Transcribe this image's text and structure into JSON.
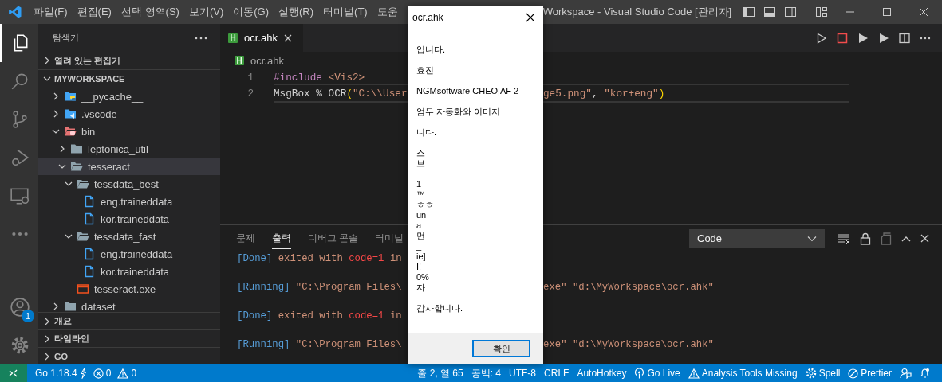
{
  "title_bar": {
    "menu": [
      "파일(F)",
      "편집(E)",
      "선택 영역(S)",
      "보기(V)",
      "이동(G)",
      "실행(R)",
      "터미널(T)",
      "도움"
    ],
    "title": "Workspace - Visual Studio Code [관리자]"
  },
  "activity_bar": {
    "items": [
      {
        "kind": "explorer",
        "selected": true
      },
      {
        "kind": "search",
        "selected": false
      },
      {
        "kind": "source-control",
        "selected": false
      },
      {
        "kind": "run-debug",
        "selected": false
      },
      {
        "kind": "remote",
        "selected": false
      },
      {
        "kind": "more",
        "selected": false
      }
    ],
    "accounts_badge": "1"
  },
  "sidebar": {
    "title": "탐색기",
    "open_editors": {
      "label": "열려 있는 편집기",
      "expanded": false
    },
    "workspace": {
      "label": "MYWORKSPACE",
      "expanded": true,
      "tree": [
        {
          "name": "__pycache__",
          "kind": "folder-python",
          "expanded": false,
          "selected": false
        },
        {
          "name": ".vscode",
          "kind": "folder-vscode",
          "expanded": false,
          "selected": false
        },
        {
          "name": "bin",
          "kind": "folder-bin",
          "expanded": true,
          "selected": false,
          "children": [
            {
              "name": "leptonica_util",
              "kind": "folder",
              "expanded": false,
              "selected": false
            },
            {
              "name": "tesseract",
              "kind": "folder",
              "expanded": true,
              "selected": true,
              "children": [
                {
                  "name": "tessdata_best",
                  "kind": "folder",
                  "expanded": true,
                  "selected": false,
                  "children": [
                    {
                      "name": "eng.traineddata",
                      "kind": "file",
                      "selected": false
                    },
                    {
                      "name": "kor.traineddata",
                      "kind": "file",
                      "selected": false
                    }
                  ]
                },
                {
                  "name": "tessdata_fast",
                  "kind": "folder",
                  "expanded": true,
                  "selected": false,
                  "children": [
                    {
                      "name": "eng.traineddata",
                      "kind": "file",
                      "selected": false
                    },
                    {
                      "name": "kor.traineddata",
                      "kind": "file",
                      "selected": false
                    }
                  ]
                },
                {
                  "name": "tesseract.exe",
                  "kind": "exe",
                  "selected": false
                }
              ]
            }
          ]
        },
        {
          "name": "dataset",
          "kind": "folder",
          "expanded": false,
          "selected": false
        }
      ]
    },
    "sections": [
      {
        "label": "개요",
        "expanded": false
      },
      {
        "label": "타임라인",
        "expanded": false
      },
      {
        "label": "GO",
        "expanded": false
      }
    ]
  },
  "editor": {
    "tabs": [
      {
        "icon": "H",
        "label": "ocr.ahk",
        "selected": true
      }
    ],
    "breadcrumb": {
      "icon": "H",
      "label": "ocr.ahk"
    },
    "lines": [
      {
        "number": "1",
        "current": false,
        "before": [
          {
            "kind": "directive",
            "text": "#include"
          },
          {
            "kind": "string",
            "text": " <Vis2>"
          }
        ]
      },
      {
        "number": "2",
        "current": true,
        "before": [
          {
            "kind": "plain",
            "text": "MsgBox % OCR"
          },
          {
            "kind": "paren",
            "text": "("
          },
          {
            "kind": "string",
            "text": "\"C:\\\\User"
          }
        ],
        "after": [
          {
            "kind": "string",
            "text": "ge5.png\""
          },
          {
            "kind": "plain",
            "text": ", "
          },
          {
            "kind": "string",
            "text": "\"kor+eng\""
          },
          {
            "kind": "paren",
            "text": ")"
          }
        ]
      }
    ]
  },
  "panel": {
    "tabs": [
      {
        "label": "문제",
        "selected": false
      },
      {
        "label": "출력",
        "selected": true
      },
      {
        "label": "디버그 콘솔",
        "selected": false
      },
      {
        "label": "터미널",
        "selected": false
      }
    ],
    "filter": "Code",
    "output": [
      {
        "before": [
          {
            "kind": "tag",
            "text": "[Done]"
          },
          {
            "kind": "text",
            "text": " exited with "
          },
          {
            "kind": "error",
            "text": "code=1"
          },
          {
            "kind": "text",
            "text": " in"
          }
        ]
      },
      {
        "before": [
          {
            "kind": "tag",
            "text": "[Running]"
          },
          {
            "kind": "text",
            "text": " \"C:\\Program Files\\"
          }
        ],
        "after": [
          {
            "kind": "text",
            "text": "exe\" \"d:\\MyWorkspace\\ocr.ahk\""
          }
        ]
      },
      {
        "before": [
          {
            "kind": "tag",
            "text": "[Done]"
          },
          {
            "kind": "text",
            "text": " exited with "
          },
          {
            "kind": "error",
            "text": "code=1"
          },
          {
            "kind": "text",
            "text": " in"
          }
        ]
      },
      {
        "before": [
          {
            "kind": "tag",
            "text": "[Running]"
          },
          {
            "kind": "text",
            "text": " \"C:\\Program Files\\"
          }
        ],
        "after": [
          {
            "kind": "text",
            "text": "exe\" \"d:\\MyWorkspace\\ocr.ahk\""
          }
        ]
      }
    ]
  },
  "dialog": {
    "title": "ocr.ahk",
    "message": "입니다.\n\n효진\n\nNGMsoftware CHEO|AF 2\n\n엄무 자동화와 이미지\n\n니다.\n\n스\n브\n\n1\n™\nㅎㅎ\nun\na\n먼\n_\nie]\nI!\n0%\n자\n\n감사합니다.",
    "button": "확인"
  },
  "status_bar": {
    "left": [
      {
        "kind": "go",
        "text": "Go 1.18.4"
      },
      {
        "kind": "errors",
        "text": "0"
      },
      {
        "kind": "warnings",
        "text": "0"
      }
    ],
    "right": [
      {
        "kind": "plain",
        "text": "줄 2, 열 65"
      },
      {
        "kind": "plain",
        "text": "공백: 4"
      },
      {
        "kind": "plain",
        "text": "UTF-8"
      },
      {
        "kind": "plain",
        "text": "CRLF"
      },
      {
        "kind": "plain",
        "text": "AutoHotkey"
      },
      {
        "kind": "live",
        "text": "Go Live"
      },
      {
        "kind": "warnings",
        "text": "Analysis Tools Missing"
      },
      {
        "kind": "gear",
        "text": "Spell"
      },
      {
        "kind": "blocked",
        "text": "Prettier"
      },
      {
        "kind": "feedback"
      },
      {
        "kind": "bell"
      }
    ]
  }
}
